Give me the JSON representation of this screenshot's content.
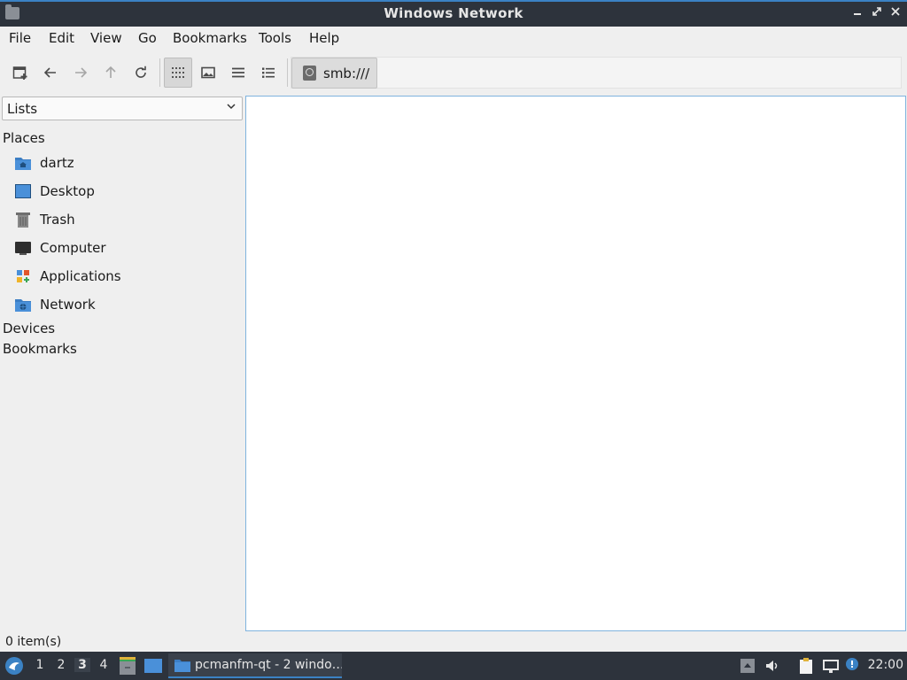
{
  "window": {
    "title": "Windows Network",
    "controls": [
      "minimize",
      "maximize",
      "close"
    ]
  },
  "menu": {
    "file": "File",
    "edit": "Edit",
    "view": "View",
    "go": "Go",
    "bookmarks": "Bookmarks",
    "tools": "Tools",
    "help": "Help"
  },
  "toolbar": {
    "buttons": [
      "new-tab",
      "back",
      "forward",
      "up",
      "reload",
      "icon-view",
      "thumbnail-view",
      "compact-view",
      "detailed-list-view"
    ],
    "active_view": "icon-view"
  },
  "pathbar": {
    "segment": "smb:///"
  },
  "side_panel": {
    "mode": "Lists",
    "places_heading": "Places",
    "places": [
      {
        "label": "dartz",
        "icon": "home-folder-icon"
      },
      {
        "label": "Desktop",
        "icon": "desktop-icon"
      },
      {
        "label": "Trash",
        "icon": "trash-icon"
      },
      {
        "label": "Computer",
        "icon": "computer-icon"
      },
      {
        "label": "Applications",
        "icon": "applications-icon"
      },
      {
        "label": "Network",
        "icon": "network-folder-icon"
      }
    ],
    "devices_heading": "Devices",
    "bookmarks_heading": "Bookmarks"
  },
  "status": {
    "text": "0 item(s)"
  },
  "taskbar": {
    "workspaces": [
      "1",
      "2",
      "3",
      "4"
    ],
    "current_workspace": "3",
    "task_label": "pcmanfm-qt - 2 windo…",
    "clock": "22:00"
  },
  "colors": {
    "titlebar": "#2d333c",
    "accent": "#3b82c4",
    "content_border": "#7fb3de",
    "window_bg": "#efefef"
  }
}
